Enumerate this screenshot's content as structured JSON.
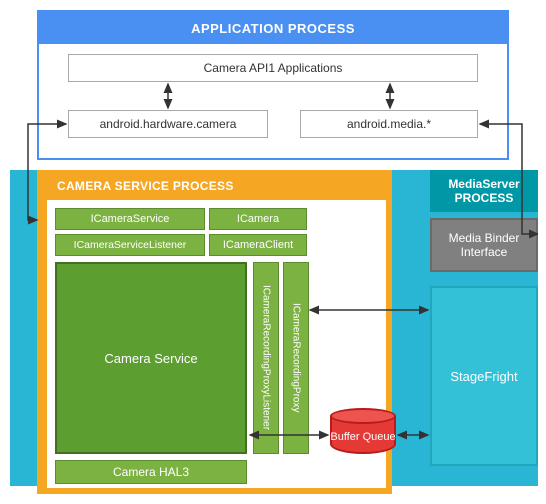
{
  "app_process": {
    "title": "APPLICATION PROCESS",
    "camera_api_apps": "Camera API1 Applications",
    "android_hw_camera": "android.hardware.camera",
    "android_media": "android.media.*"
  },
  "camera_service_process": {
    "title": "CAMERA SERVICE PROCESS",
    "icamera_service": "ICameraService",
    "icamera": "ICamera",
    "icamera_service_listener": "ICameraServiceListener",
    "icamera_client": "ICameraClient",
    "camera_service": "Camera Service",
    "rec_proxy_listener": "ICameraRecordingProxyListener",
    "rec_proxy": "ICameraRecordingProxy",
    "camera_hal3": "Camera HAL3"
  },
  "mediaserver_process": {
    "title": "MediaServer PROCESS",
    "media_binder": "Media Binder Interface",
    "stagefright": "StageFright"
  },
  "buffer_queue": "Buffer Queue",
  "colors": {
    "app_header": "#4a90f2",
    "camera_svc": "#f5a623",
    "cyan": "#29b6d4",
    "mediasrv_header": "#0097a7",
    "gray": "#808080",
    "stagefright": "#33c1d8",
    "green_light": "#7bb241",
    "green_dark": "#5c9e2f",
    "red": "#e53935"
  }
}
